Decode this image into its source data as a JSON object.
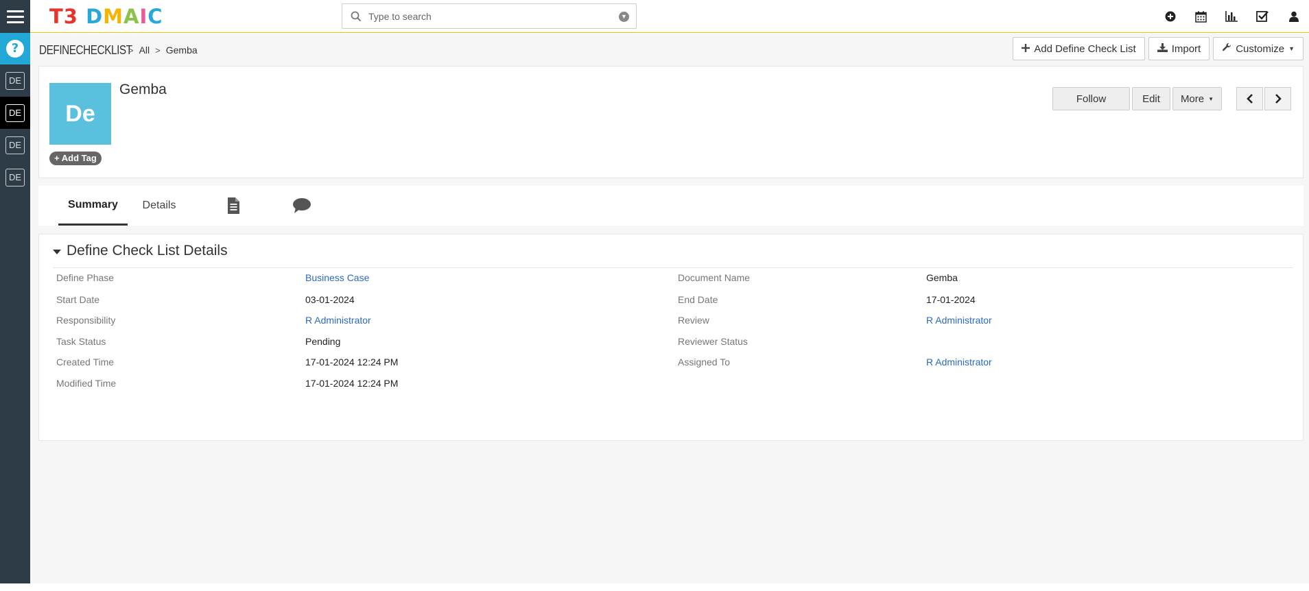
{
  "app": {
    "logo_letters": [
      {
        "char": "T",
        "color": "#e8322b"
      },
      {
        "char": "3",
        "color": "#e8322b"
      },
      {
        "char": " ",
        "color": "#ffffff"
      },
      {
        "char": "D",
        "color": "#29a7d6"
      },
      {
        "char": "M",
        "color": "#f5b400"
      },
      {
        "char": "A",
        "color": "#8bc34a"
      },
      {
        "char": "I",
        "color": "#e85a9a"
      },
      {
        "char": "C",
        "color": "#29a7d6"
      }
    ],
    "logo_text": "T3 DMAIC"
  },
  "search": {
    "placeholder": "Type to search"
  },
  "header_icons": [
    "plus-circle-icon",
    "calendar-icon",
    "bar-chart-icon",
    "checkbox-icon",
    "user-icon"
  ],
  "rail": {
    "items": [
      "DE",
      "DE",
      "DE",
      "DE"
    ],
    "active_index": 1
  },
  "breadcrumb": {
    "module": "DEFINECHECKLIST",
    "all": "All",
    "current": "Gemba"
  },
  "top_actions": {
    "add_label": "Add Define Check List",
    "import_label": "Import",
    "customize_label": "Customize"
  },
  "record": {
    "avatar_text": "De",
    "title": "Gemba",
    "add_tag_label": "Add Tag",
    "follow_label": "Follow",
    "edit_label": "Edit",
    "more_label": "More"
  },
  "tabs": {
    "summary": "Summary",
    "details": "Details"
  },
  "section": {
    "title": "Define Check List Details",
    "fields_left": [
      {
        "label": "Define Phase",
        "value": "Business Case",
        "link": true
      },
      {
        "label": "Start Date",
        "value": "03-01-2024",
        "link": false
      },
      {
        "label": "Responsibility",
        "value": "R Administrator",
        "link": true
      },
      {
        "label": "Task Status",
        "value": "Pending",
        "link": false
      },
      {
        "label": "Created Time",
        "value": "17-01-2024 12:24 PM",
        "link": false
      },
      {
        "label": "Modified Time",
        "value": "17-01-2024 12:24 PM",
        "link": false
      }
    ],
    "fields_right": [
      {
        "label": "Document Name",
        "value": "Gemba",
        "link": false
      },
      {
        "label": "End Date",
        "value": "17-01-2024",
        "link": false
      },
      {
        "label": "Review",
        "value": "R Administrator",
        "link": true
      },
      {
        "label": "Reviewer Status",
        "value": "",
        "link": false
      },
      {
        "label": "Assigned To",
        "value": "R Administrator",
        "link": true
      }
    ]
  },
  "colors": {
    "accent": "#f0c000",
    "rail": "#2d3c47",
    "help": "#22a8d7",
    "avatar": "#5bc0de",
    "link": "#2a6ac0"
  }
}
